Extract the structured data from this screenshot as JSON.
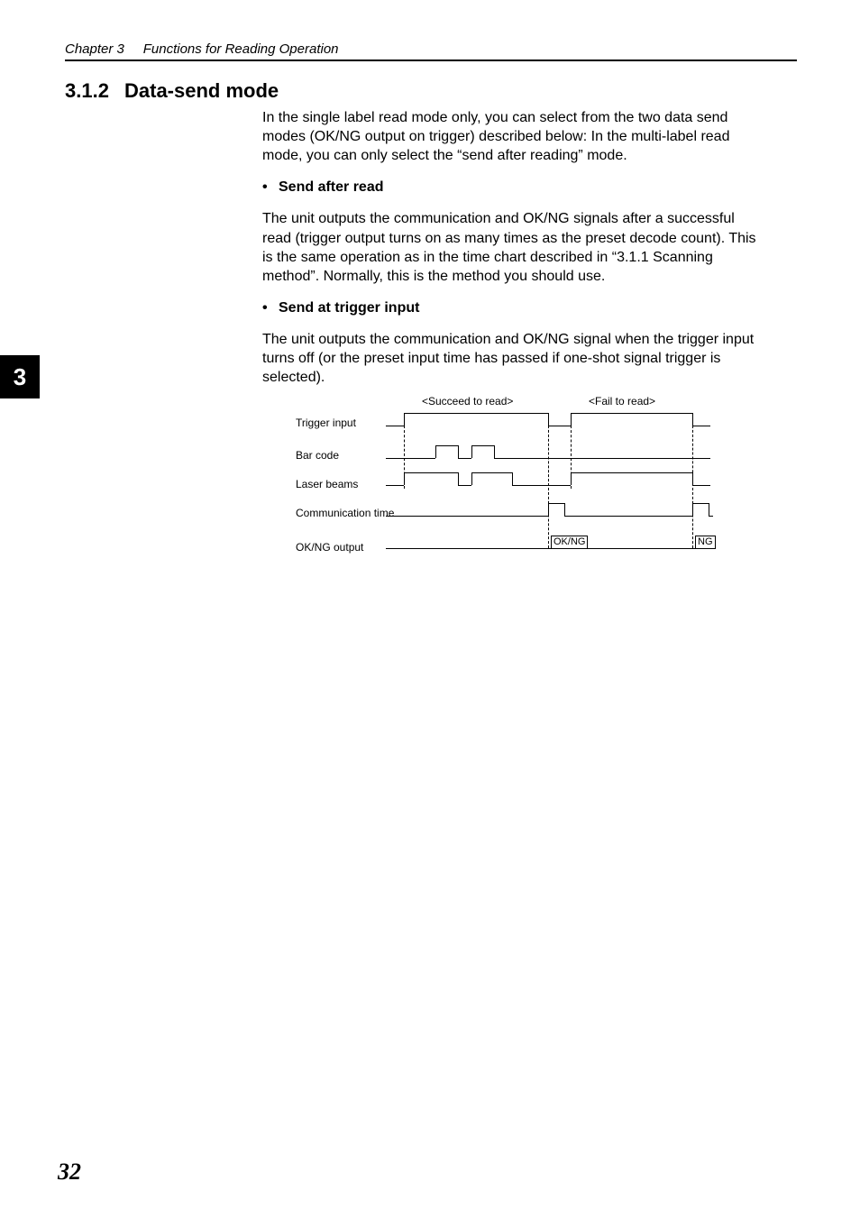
{
  "header": {
    "chapter": "Chapter 3",
    "title": "Functions for Reading Operation"
  },
  "section": {
    "number": "3.1.2",
    "title": "Data-send mode"
  },
  "paragraphs": {
    "intro": "In the single label read mode only, you can select from the two data send modes (OK/NG output on trigger) described below: In the multi-label read mode, you can only select the “send after reading” mode.",
    "bullet1_title": "Send after read",
    "bullet1_body": "The unit outputs the communication and OK/NG signals after a successful read (trigger output turns on as many times as the preset decode count). This is the same operation as in the time chart described in “3.1.1 Scanning method”. Normally, this is the method you should use.",
    "bullet2_title": "Send at trigger input",
    "bullet2_body": "The unit outputs the communication and OK/NG signal when the trigger input turns off (or the preset input time has passed if one-shot signal trigger is selected)."
  },
  "tab": "3",
  "chart_data": {
    "type": "timing-diagram",
    "columns": [
      "<Succeed to read>",
      "<Fail to read>"
    ],
    "signals": [
      "Trigger input",
      "Bar code",
      "Laser beams",
      "Communication time",
      "OK/NG output"
    ],
    "output_labels": {
      "succeed": "OK/NG",
      "fail": "NG"
    }
  },
  "page_number": "32"
}
